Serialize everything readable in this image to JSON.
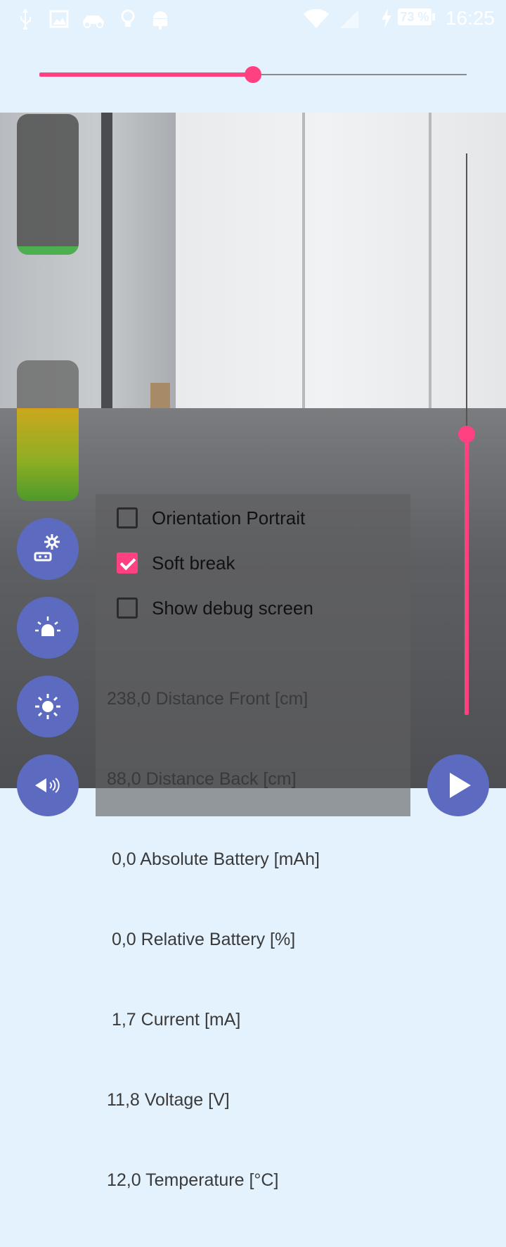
{
  "status_bar": {
    "time": "16:25",
    "battery": "73 %",
    "icons": [
      "usb-icon",
      "image-icon",
      "car-icon",
      "lightbulb-icon",
      "android-icon",
      "wifi-icon",
      "signal-icon",
      "charging-icon"
    ]
  },
  "speed_slider": {
    "value_fraction": 0.5
  },
  "steer_slider": {
    "value_fraction": 0.5
  },
  "gauges": {
    "top_level_fraction": 0.06,
    "bottom_level_fraction": 0.65
  },
  "buttons": {
    "settings_icon": "settings-gear-icon",
    "siren_icon": "siren-icon",
    "light_icon": "sun-icon",
    "horn_icon": "horn-icon",
    "play_icon": "play-icon"
  },
  "options": [
    {
      "label": "Orientation Portrait",
      "checked": false
    },
    {
      "label": "Soft break",
      "checked": true
    },
    {
      "label": "Show debug screen",
      "checked": false
    }
  ],
  "readouts": [
    "238,0 Distance Front [cm]",
    "88,0 Distance Back [cm]",
    " 0,0 Absolute Battery [mAh]",
    " 0,0 Relative Battery [%]",
    " 1,7 Current [mA]",
    "11,8 Voltage [V]",
    "12,0 Temperature [°C]"
  ],
  "colors": {
    "accent": "#ff4081",
    "fab": "#5c6bc0",
    "background": "#e3f2fd"
  }
}
